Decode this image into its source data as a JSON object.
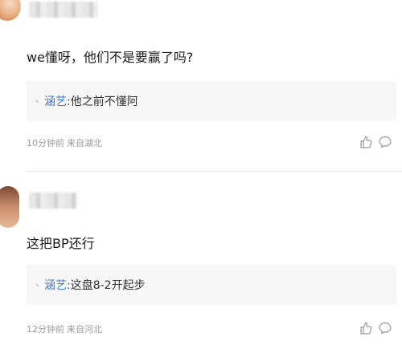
{
  "comments": [
    {
      "text": "we懂呀，他们不是要赢了吗?",
      "reply": {
        "marker": "、",
        "author": "涵艺",
        "separator": ":",
        "text": "他之前不懂阿"
      },
      "meta": {
        "time": "10分钟前",
        "location": "来自湖北"
      },
      "actions": {
        "like_icon": "thumbs-up-icon",
        "comment_icon": "speech-bubble-icon"
      }
    },
    {
      "text": "这把BP还行",
      "reply": {
        "marker": "、",
        "author": "涵艺",
        "separator": ":",
        "text": "这盘8-2开起步"
      },
      "meta": {
        "time": "12分钟前",
        "location": "来自河北"
      },
      "actions": {
        "like_icon": "thumbs-up-icon",
        "comment_icon": "speech-bubble-icon"
      }
    }
  ],
  "colors": {
    "reply_author": "#3d7bd6",
    "meta_text": "#999999",
    "reply_background": "#f7f7f7",
    "divider": "#e6e6e6"
  }
}
